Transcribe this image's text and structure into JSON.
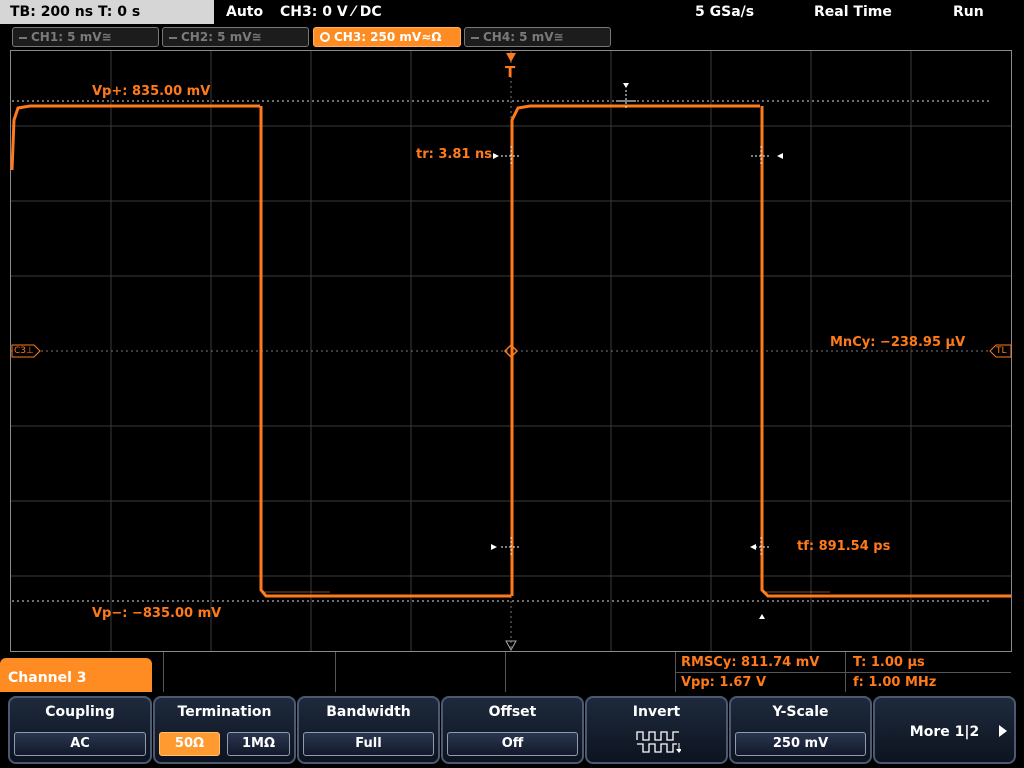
{
  "topbar": {
    "timebase": "TB: 200 ns   T: 0 s",
    "trigger_mode": "Auto",
    "trigger_source": "CH3: 0 V ⁄ DC",
    "sample_rate": "5 GSa/s",
    "acq_mode": "Real Time",
    "run_state": "Run"
  },
  "channels": {
    "ch1": "CH1: 5 mV≅",
    "ch2": "CH2: 5 mV≅",
    "ch3": "CH3: 250 mV≈Ω",
    "ch4": "CH4: 5 mV≅"
  },
  "markers": {
    "trigger": "T",
    "ch3_ref": "C3⊥",
    "trigger_level": "TL"
  },
  "measurements_on_screen": {
    "vp_plus": "Vp+: 835.00 mV",
    "vp_minus": "Vp−: −835.00 mV",
    "rise_time": "tr: 3.81 ns",
    "fall_time": "tf: 891.54 ps",
    "mean_cycle": "MnCy: −238.95 µV"
  },
  "measurement_table": {
    "rms_cycle": "RMSCy: 811.74 mV",
    "vpp": "Vpp: 1.67 V",
    "period": "T: 1.00 µs",
    "frequency": "f: 1.00 MHz"
  },
  "menu": {
    "title": "Channel 3",
    "coupling": {
      "label": "Coupling",
      "value": "AC"
    },
    "termination": {
      "label": "Termination",
      "opt1": "50Ω",
      "opt2": "1MΩ"
    },
    "bandwidth": {
      "label": "Bandwidth",
      "value": "Full"
    },
    "offset": {
      "label": "Offset",
      "value": "Off"
    },
    "invert": {
      "label": "Invert"
    },
    "yscale": {
      "label": "Y-Scale",
      "value": "250 mV"
    },
    "more": {
      "label": "More 1|2"
    }
  },
  "colors": {
    "ch3": "#ff7a1a",
    "grid": "#4a4a4a",
    "accent": "#ff8c22"
  }
}
